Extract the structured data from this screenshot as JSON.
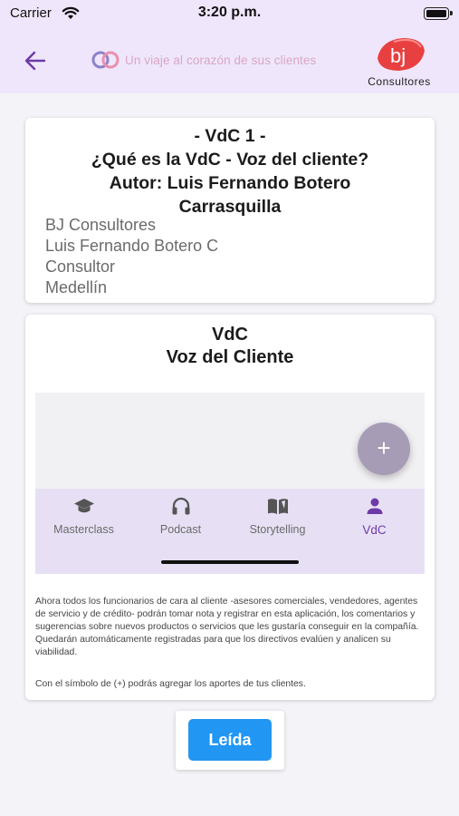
{
  "status_bar": {
    "carrier": "Carrier",
    "time": "3:20 p.m."
  },
  "header": {
    "tagline": "Un viaje al corazón de sus clientes",
    "brand_name": "Consultores",
    "brand_logo_text": "bj",
    "colors": {
      "appbar_bg": "#efe6fb",
      "back_arrow": "#6e3aa6",
      "brand_red": "#e84040"
    }
  },
  "article": {
    "heading_lines": [
      "- VdC 1 -",
      "¿Qué es la VdC - Voz del cliente?",
      "Autor: Luis Fernando Botero",
      "Carrasquilla"
    ],
    "info_lines": [
      "BJ Consultores",
      "Luis Fernando Botero C",
      "Consultor",
      "Medellín"
    ]
  },
  "content": {
    "title": "VdC",
    "subtitle": "Voz del Cliente",
    "preview": {
      "fab_symbol": "+",
      "nav_items": [
        {
          "label": "Masterclass",
          "icon": "graduation-cap-icon",
          "active": false
        },
        {
          "label": "Podcast",
          "icon": "headphones-icon",
          "active": false
        },
        {
          "label": "Storytelling",
          "icon": "book-icon",
          "active": false
        },
        {
          "label": "VdC",
          "icon": "person-icon",
          "active": true
        }
      ]
    },
    "paragraph": "Ahora todos los funcionarios de cara al cliente -asesores comerciales, vendedores, agentes de servicio y de crédito- podrán tomar nota y registrar en esta aplicación, los comentarios y sugerencias sobre nuevos productos o servicios que les gustaría conseguir en la compañía. Quedarán automáticamente registradas para que los directivos evalúen y analicen su viabilidad.",
    "hint": "Con el símbolo de (+) podrás agregar los aportes de tus clientes."
  },
  "action": {
    "read_button": "Leída",
    "button_color": "#2196f3"
  }
}
